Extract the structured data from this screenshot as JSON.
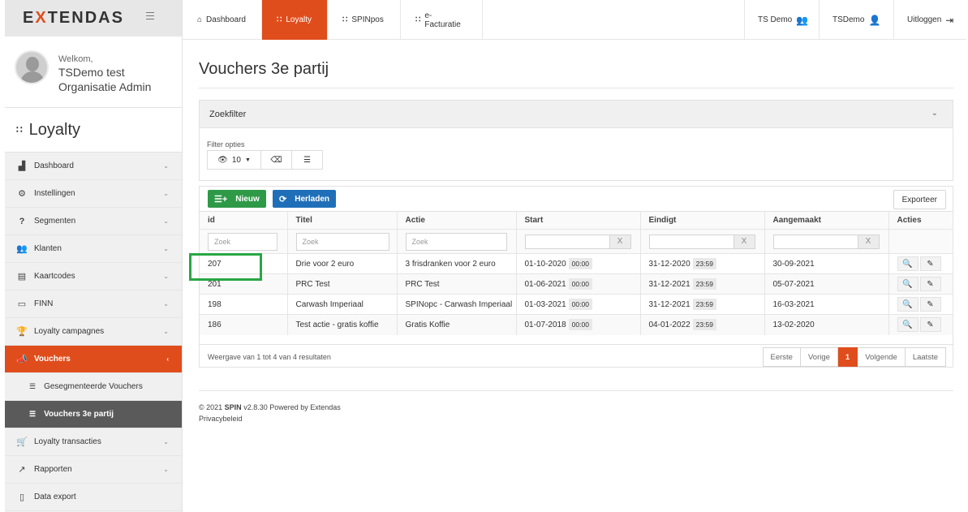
{
  "app": {
    "logo": "EXTENDAS"
  },
  "user": {
    "welcome": "Welkom,",
    "name": "TSDemo test",
    "role": "Organisatie Admin"
  },
  "module": {
    "title": "Loyalty"
  },
  "sidebar": {
    "items": [
      {
        "label": "Dashboard",
        "icon": "bar-chart-icon"
      },
      {
        "label": "Instellingen",
        "icon": "gear-icon"
      },
      {
        "label": "Segmenten",
        "icon": "question-icon"
      },
      {
        "label": "Klanten",
        "icon": "users-icon"
      },
      {
        "label": "Kaartcodes",
        "icon": "card-icon"
      },
      {
        "label": "FINN",
        "icon": "credit-card-icon"
      },
      {
        "label": "Loyalty campagnes",
        "icon": "trophy-icon"
      },
      {
        "label": "Vouchers",
        "icon": "megaphone-icon"
      },
      {
        "label": "Loyalty transacties",
        "icon": "cart-icon"
      },
      {
        "label": "Rapporten",
        "icon": "line-chart-icon"
      },
      {
        "label": "Data export",
        "icon": "file-icon"
      }
    ],
    "sub": [
      {
        "label": "Gesegmenteerde Vouchers"
      },
      {
        "label": "Vouchers 3e partij"
      }
    ]
  },
  "topnav": {
    "tabs": [
      {
        "label": "Dashboard"
      },
      {
        "label": "Loyalty"
      },
      {
        "label": "SPINpos"
      },
      {
        "label": "e-Facturatie"
      }
    ],
    "right": [
      {
        "label": "TS Demo"
      },
      {
        "label": "TSDemo"
      },
      {
        "label": "Uitloggen"
      }
    ]
  },
  "page": {
    "title": "Vouchers 3e partij"
  },
  "filter": {
    "header": "Zoekfilter",
    "options_label": "Filter opties",
    "rows_value": "10"
  },
  "toolbar": {
    "new_label": "Nieuw",
    "reload_label": "Herladen",
    "export_label": "Exporteer"
  },
  "table": {
    "columns": [
      "id",
      "Titel",
      "Actie",
      "Start",
      "Eindigt",
      "Aangemaakt",
      "Acties"
    ],
    "filter_placeholder": "Zoek",
    "rows": [
      {
        "id": "207",
        "title": "Drie voor 2 euro",
        "action": "3 frisdranken voor 2 euro",
        "start": "01-10-2020",
        "start_time": "00:00",
        "end": "31-12-2020",
        "end_time": "23:59",
        "created": "30-09-2021"
      },
      {
        "id": "201",
        "title": "PRC Test",
        "action": "PRC Test",
        "start": "01-06-2021",
        "start_time": "00:00",
        "end": "31-12-2021",
        "end_time": "23:59",
        "created": "05-07-2021"
      },
      {
        "id": "198",
        "title": "Carwash Imperiaal",
        "action": "SPINopc - Carwash Imperiaal",
        "start": "01-03-2021",
        "start_time": "00:00",
        "end": "31-12-2021",
        "end_time": "23:59",
        "created": "16-03-2021"
      },
      {
        "id": "186",
        "title": "Test actie - gratis koffie",
        "action": "Gratis Koffie",
        "start": "01-07-2018",
        "start_time": "00:00",
        "end": "04-01-2022",
        "end_time": "23:59",
        "created": "13-02-2020"
      }
    ],
    "summary": "Weergave van 1 tot 4 van 4 resultaten"
  },
  "pager": {
    "first": "Eerste",
    "prev": "Vorige",
    "current": "1",
    "next": "Volgende",
    "last": "Laatste"
  },
  "footer": {
    "copyright": "© 2021",
    "brand": "SPIN",
    "version": "v2.8.30 Powered by Extendas",
    "privacy": "Privacybeleid"
  },
  "colors": {
    "accent": "#e04d1c",
    "new_button": "#2e9a48",
    "reload_button": "#1f6fb8",
    "highlight": "#28a745"
  }
}
